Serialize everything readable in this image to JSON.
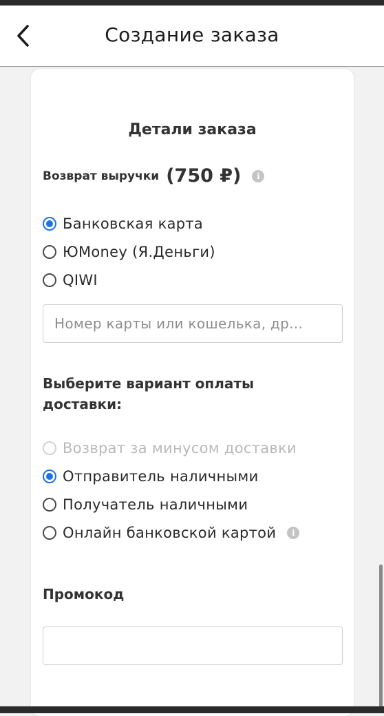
{
  "header": {
    "title": "Создание заказа",
    "back_icon": "chevron-left-icon"
  },
  "order_details": {
    "title": "Детали заказа",
    "refund_label": "Возврат выручки",
    "refund_amount": "(750 ₽)",
    "payout_methods": [
      {
        "label": "Банковская карта",
        "selected": true
      },
      {
        "label": "ЮMoney (Я.Деньги)",
        "selected": false
      },
      {
        "label": "QIWI",
        "selected": false
      }
    ],
    "account_input": {
      "placeholder": "Номер карты или кошелька, др...",
      "value": ""
    }
  },
  "delivery_payment": {
    "title": "Выберите вариант оплаты доставки:",
    "options": [
      {
        "label": "Возврат за минусом доставки",
        "selected": false,
        "disabled": true
      },
      {
        "label": "Отправитель наличными",
        "selected": true,
        "disabled": false
      },
      {
        "label": "Получатель наличными",
        "selected": false,
        "disabled": false
      },
      {
        "label": "Онлайн банковской картой",
        "selected": false,
        "disabled": false
      }
    ]
  },
  "promo": {
    "title": "Промокод",
    "value": ""
  },
  "icons": {
    "info": "i"
  },
  "colors": {
    "accent": "#1a73e8",
    "info_icon": "#c4c4c4",
    "disabled_text": "#b9b9b9"
  }
}
